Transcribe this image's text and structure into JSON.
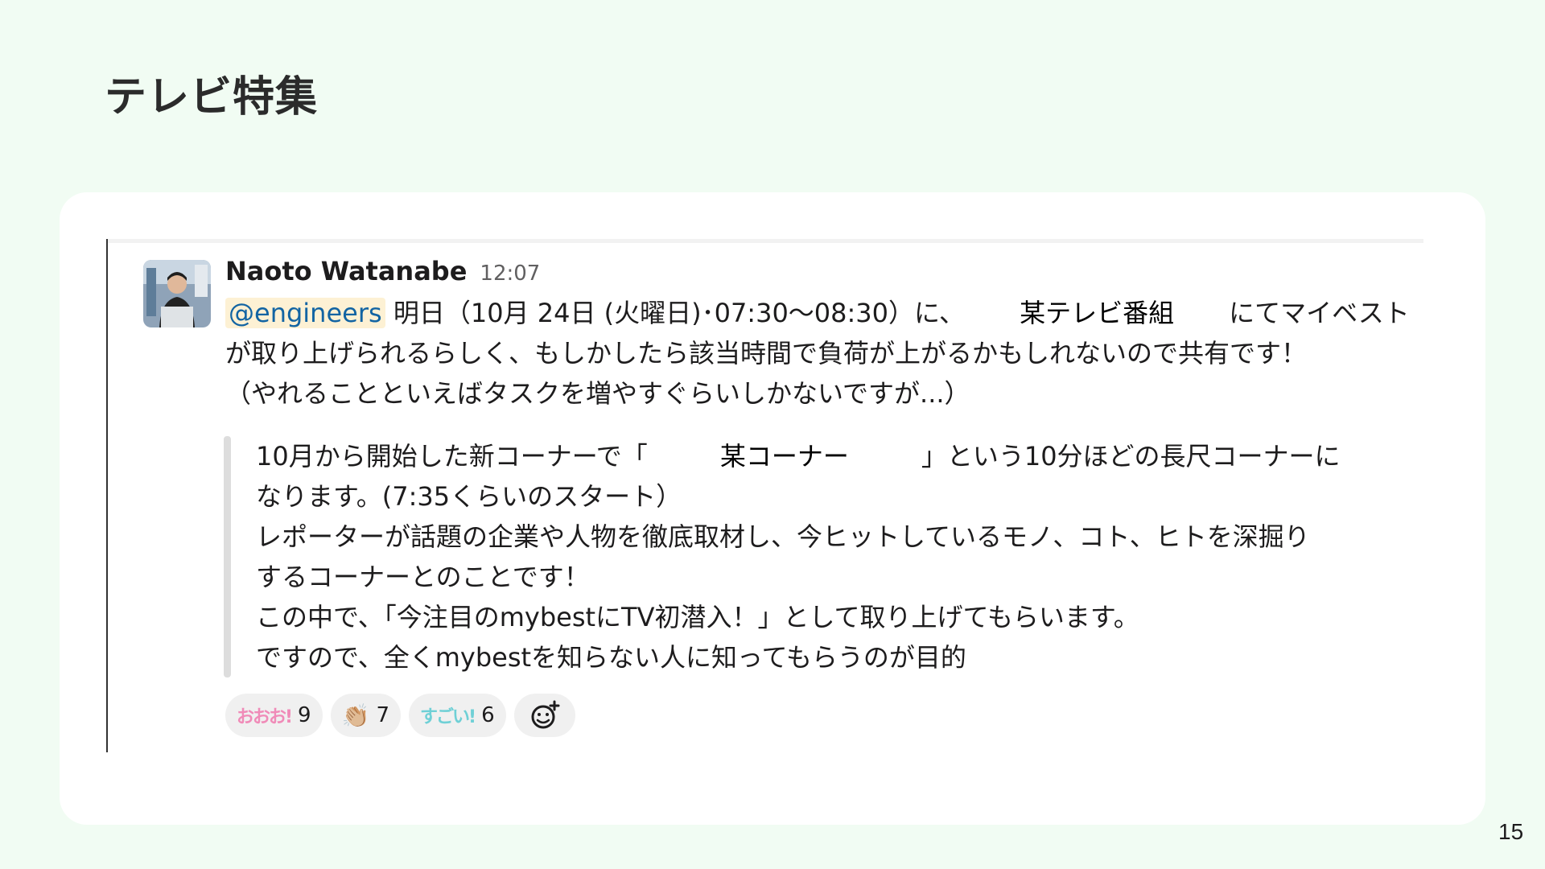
{
  "slide": {
    "title": "テレビ特集",
    "page_number": "15"
  },
  "message": {
    "sender": "Naoto Watanabe",
    "time": "12:07",
    "mention": "@engineers",
    "line1_before": " 明日（10月 24日 (火曜日)･07:30〜08:30）に、",
    "program_name": "某テレビ番組",
    "line1_after": "にてマイベスト",
    "line2": "が取り上げられるらしく、もしかしたら該当時間で負荷が上がるかもしれないので共有です！",
    "line3": "（やれることといえばタスクを増やすぐらいしかないですが...）"
  },
  "quote": {
    "line1_before": "10月から開始した新コーナーで「",
    "corner_name": "某コーナー",
    "line1_after": "」という10分ほどの長尺コーナーに",
    "line2": "なります。(7:35くらいのスタート）",
    "line3": "レポーターが話題の企業や人物を徹底取材し、今ヒットしているモノ、コト、ヒトを深掘り",
    "line4": "するコーナーとのことです！",
    "line5": "この中で、「今注目のmybestにTV初潜入！」として取り上げてもらいます。",
    "line6": "ですので、全くmybestを知らない人に知ってもらうのが目的"
  },
  "reactions": [
    {
      "emoji": "おおお!",
      "icon": "ooo-emoji-icon",
      "count": "9"
    },
    {
      "emoji": "👏🏼",
      "icon": "clap-emoji-icon",
      "count": "7"
    },
    {
      "emoji": "すごい!",
      "icon": "sugoi-emoji-icon",
      "count": "6"
    }
  ],
  "colors": {
    "background": "#f1fcf3",
    "card": "#ffffff",
    "mention_bg": "#fdf1d4",
    "mention_text": "#1264a3"
  }
}
